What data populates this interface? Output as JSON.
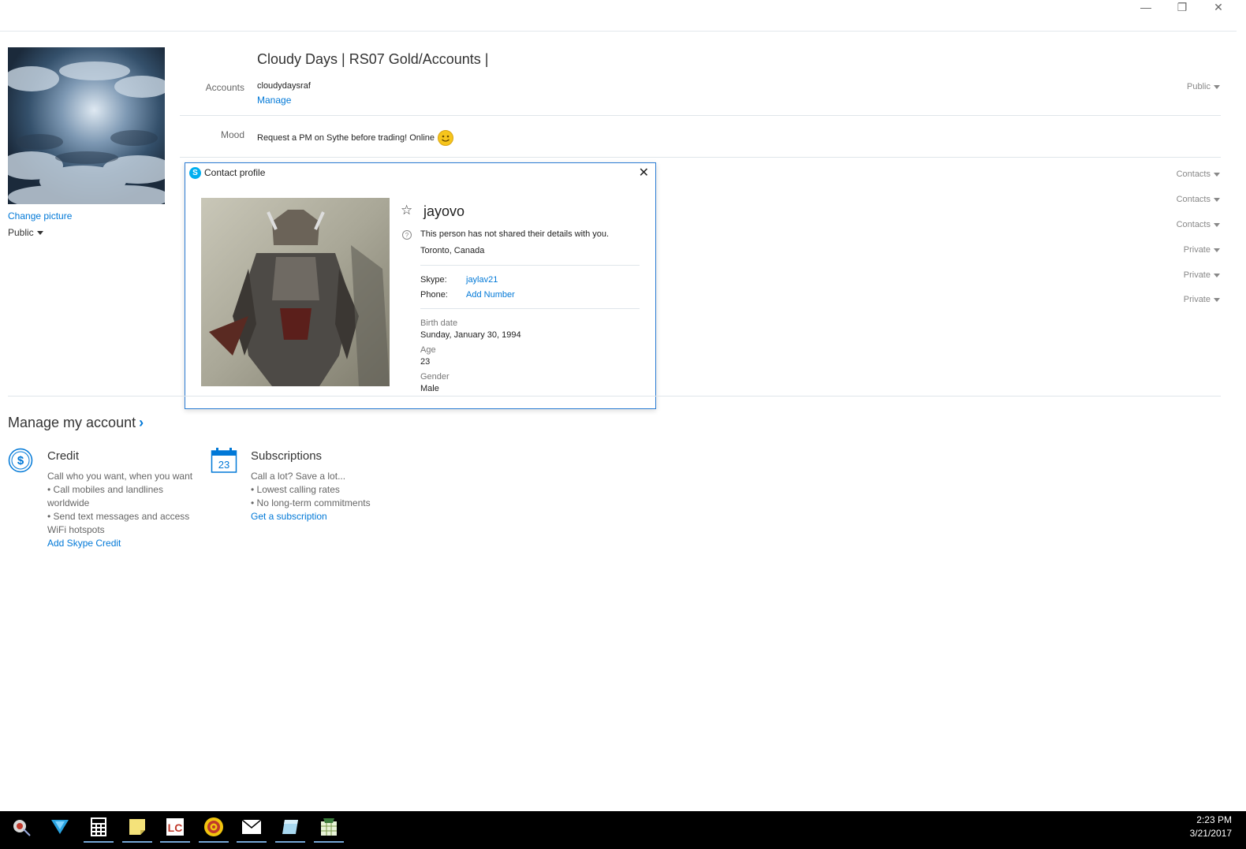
{
  "window": {
    "minimize_glyph": "—",
    "restore_glyph": "❐",
    "close_glyph": "✕"
  },
  "profile": {
    "change_picture": "Change picture",
    "visibility": "Public",
    "display_name": "Cloudy Days | RS07 Gold/Accounts |",
    "accounts_label": "Accounts",
    "account_name": "cloudydaysraf",
    "manage": "Manage",
    "accounts_privacy": "Public",
    "mood_label": "Mood",
    "mood_text": "Request a PM on Sythe before trading! Online",
    "privacy_rows": [
      "Contacts",
      "Contacts",
      "Contacts",
      "Private",
      "Private",
      "Private"
    ]
  },
  "dialog": {
    "title": "Contact profile",
    "name": "jayovo",
    "notice": "This person has not shared their details with you.",
    "location": "Toronto, Canada",
    "skype_label": "Skype:",
    "skype_value": "jaylav21",
    "phone_label": "Phone:",
    "phone_value": "Add Number",
    "birth_label": "Birth date",
    "birth_value": "Sunday, January 30, 1994",
    "age_label": "Age",
    "age_value": "23",
    "gender_label": "Gender",
    "gender_value": "Male"
  },
  "manage": {
    "heading": "Manage my account",
    "credit": {
      "title": "Credit",
      "lines": [
        "Call who you want, when you want",
        "• Call mobiles and landlines",
        "worldwide",
        "• Send text messages and access",
        "WiFi hotspots"
      ],
      "link": "Add Skype Credit"
    },
    "subscriptions": {
      "title": "Subscriptions",
      "calendar_day": "23",
      "lines": [
        "Call a lot? Save a lot...",
        "• Lowest calling rates",
        "• No long-term commitments"
      ],
      "link": "Get a subscription"
    }
  },
  "taskbar": {
    "time": "2:23 PM",
    "date": "3/21/2017",
    "icons": [
      "snipping-tool-icon",
      "vpn-icon",
      "calculator-icon",
      "sticky-notes-icon",
      "lc-app-icon",
      "target-app-icon",
      "mail-icon",
      "notepad-icon",
      "spreadsheet-app-icon"
    ],
    "lc_text": "LC"
  },
  "colors": {
    "accent": "#0078d7",
    "dialog_border": "#2a7bd3",
    "taskbar": "#000000"
  }
}
